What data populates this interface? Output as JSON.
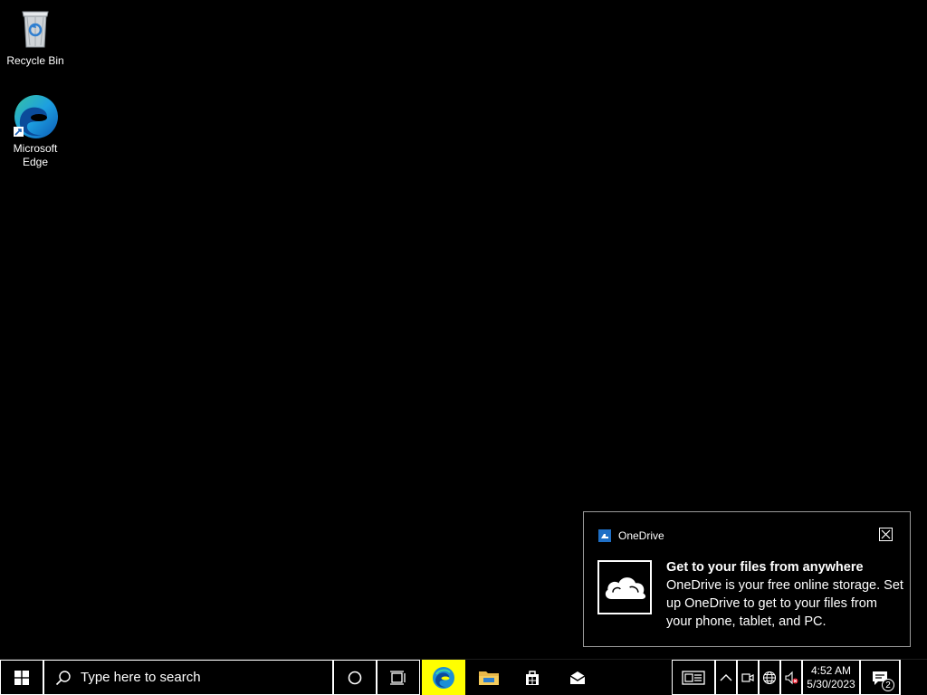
{
  "desktop": {
    "icons": [
      {
        "label": "Recycle Bin"
      },
      {
        "label": "Microsoft Edge"
      }
    ]
  },
  "toast": {
    "app_name": "OneDrive",
    "title": "Get to your files from anywhere",
    "message": "OneDrive is your free online storage. Set up OneDrive to get to your files from your phone, tablet, and PC.",
    "hero_icon": "cloud-icon",
    "close_icon": "close-icon"
  },
  "taskbar": {
    "start_icon": "windows-logo-icon",
    "search": {
      "placeholder": "Type here to search",
      "icon": "search-icon"
    },
    "pinned": [
      {
        "name": "cortana",
        "icon": "circle-icon"
      },
      {
        "name": "task-view",
        "icon": "task-view-icon"
      },
      {
        "name": "microsoft-edge",
        "icon": "edge-icon",
        "active": true,
        "highlight_color": "#ffff00"
      },
      {
        "name": "file-explorer",
        "icon": "folder-icon"
      },
      {
        "name": "microsoft-store",
        "icon": "store-bag-icon"
      },
      {
        "name": "mail",
        "icon": "mail-icon"
      }
    ],
    "tray": {
      "news_icon": "news-icon",
      "chevron_icon": "chevron-up-icon",
      "meet_icon": "meet-now-icon",
      "network_icon": "globe-network-icon",
      "volume_icon": "volume-muted-icon",
      "time": "4:52 AM",
      "date": "5/30/2023",
      "notification_count": "2",
      "action_center_icon": "action-center-icon"
    }
  }
}
